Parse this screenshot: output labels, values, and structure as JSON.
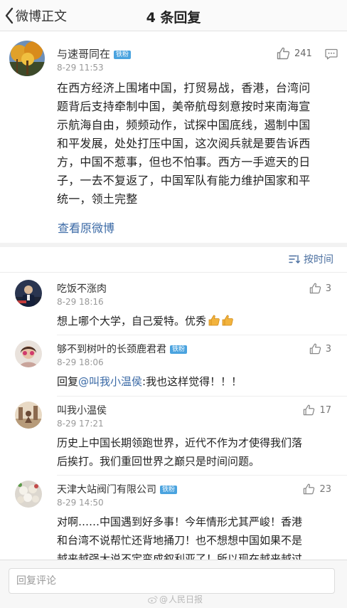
{
  "nav": {
    "back_label": "微博正文",
    "title": "4 条回复"
  },
  "post": {
    "author": "与速哥同在",
    "badge": "铁粉",
    "time": "8-29 11:53",
    "likes": "241",
    "lines": [
      "在西方经济上围堵中国，打贸易战，香港，台湾问",
      "题背后支持牵制中国，美帝航母刻意按时来南海宣",
      "示航海自由，频频动作，试探中国底线，遏制中国",
      "和平发展，处处打压中国，这次阅兵就是要告诉西",
      "方，中国不惹事，但也不怕事。西方一手遮天的日",
      "子，一去不复返了，中国军队有能力维护国家和平",
      "统一，领土完整"
    ],
    "view_original": "查看原微博"
  },
  "sort": {
    "label": "按时间"
  },
  "comments": [
    {
      "name": "吃饭不涨肉",
      "time": "8-29 18:16",
      "likes": "3",
      "text": "想上哪个大学，自己爱特。优秀"
    },
    {
      "name": "够不到树叶的长颈鹿君君",
      "badge": "铁粉",
      "time": "8-29 18:06",
      "likes": "3",
      "reply_prefix": "回复",
      "mention": "@叫我小温侯",
      "text": ":我也这样觉得！！！"
    },
    {
      "name": "叫我小温侯",
      "time": "8-29 17:21",
      "likes": "17",
      "lines": [
        "历史上中国长期领跑世界，近代不作为才使得我们落",
        "后挨打。我们重回世界之巅只是时间问题。"
      ]
    },
    {
      "name": "天津大站阀门有限公司",
      "badge": "铁粉",
      "time": "8-29 14:50",
      "likes": "23",
      "lines": [
        "对啊……中国遇到好多事！今年情形尤其严峻！香港",
        "和台湾不说帮忙还背地捅刀！也不想想中国如果不是",
        "越来越强大说不定变成叙利亚了！所以现在越来越过"
      ]
    }
  ],
  "bottom": {
    "placeholder": "回复评论",
    "watermark": "人民日报"
  },
  "colors": {
    "link": "#3b6aa6",
    "badge": "#4aa3df",
    "muted": "#999999"
  }
}
